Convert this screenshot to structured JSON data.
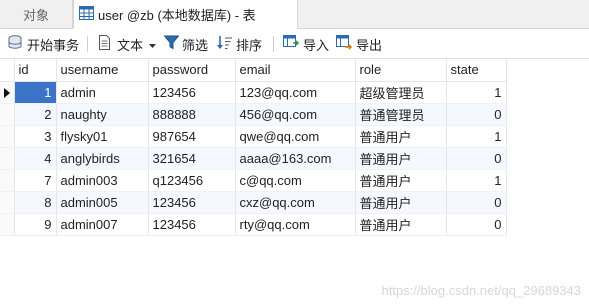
{
  "tabs": {
    "objects_label": "对象",
    "active_label": "user @zb (本地数据库) - 表"
  },
  "toolbar": {
    "begin_transaction": "开始事务",
    "text": "文本",
    "filter": "筛选",
    "sort": "排序",
    "import": "导入",
    "export": "导出"
  },
  "columns": [
    "id",
    "username",
    "password",
    "email",
    "role",
    "state"
  ],
  "rows": [
    {
      "id": "1",
      "username": "admin",
      "password": "123456",
      "email": "123@qq.com",
      "role": "超级管理员",
      "state": "1"
    },
    {
      "id": "2",
      "username": "naughty",
      "password": "888888",
      "email": "456@qq.com",
      "role": "普通管理员",
      "state": "0"
    },
    {
      "id": "3",
      "username": "flysky01",
      "password": "987654",
      "email": "qwe@qq.com",
      "role": "普通用户",
      "state": "1"
    },
    {
      "id": "4",
      "username": "anglybirds",
      "password": "321654",
      "email": "aaaa@163.com",
      "role": "普通用户",
      "state": "0"
    },
    {
      "id": "7",
      "username": "admin003",
      "password": "q123456",
      "email": "c@qq.com",
      "role": "普通用户",
      "state": "1"
    },
    {
      "id": "8",
      "username": "admin005",
      "password": "123456",
      "email": "cxz@qq.com",
      "role": "普通用户",
      "state": "0"
    },
    {
      "id": "9",
      "username": "admin007",
      "password": "123456",
      "email": "rty@qq.com",
      "role": "普通用户",
      "state": "0"
    }
  ],
  "watermark": "https://blog.csdn.net/qq_29689343",
  "colors": {
    "selected_cell": "#3b74c7",
    "icon_blue": "#2b6cb0",
    "icon_green": "#2f9e44"
  }
}
